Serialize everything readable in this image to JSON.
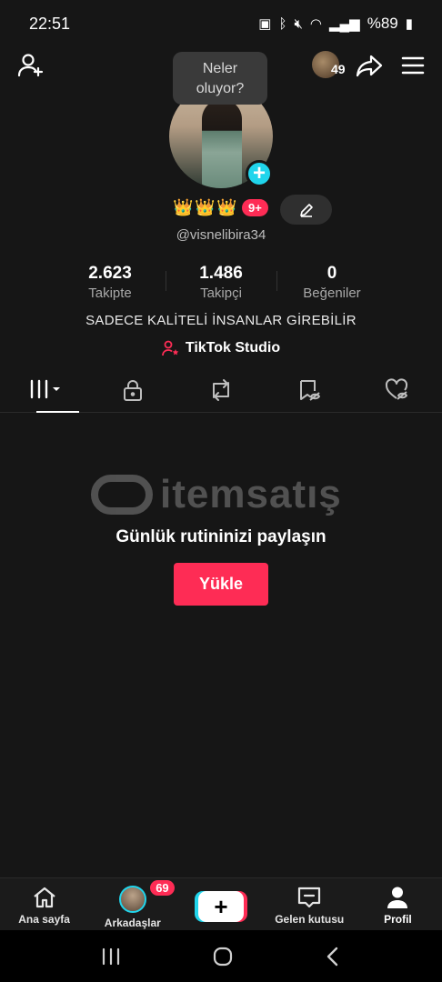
{
  "status_bar": {
    "time": "22:51",
    "battery": "%89"
  },
  "top_nav": {
    "coin_count": "49"
  },
  "tooltip": {
    "line1": "Neler",
    "line2": "oluyor?"
  },
  "profile": {
    "badge_count": "9+",
    "username": "@visnelibira34",
    "stats": [
      {
        "value": "2.623",
        "label": "Takipte"
      },
      {
        "value": "1.486",
        "label": "Takipçi"
      },
      {
        "value": "0",
        "label": "Beğeniler"
      }
    ],
    "bio": "SADECE KALİTELİ İNSANLAR GİREBİLİR",
    "studio_link": "TikTok Studio"
  },
  "watermark": {
    "text": "itemsatış"
  },
  "empty_state": {
    "title": "Günlük rutininizi paylaşın",
    "upload_label": "Yükle"
  },
  "bottom_nav": {
    "home": "Ana sayfa",
    "friends": "Arkadaşlar",
    "friends_count": "69",
    "inbox": "Gelen kutusu",
    "profile": "Profil"
  },
  "colors": {
    "accent": "#fe2c55",
    "cyan": "#20d5ec",
    "background": "#161616"
  }
}
